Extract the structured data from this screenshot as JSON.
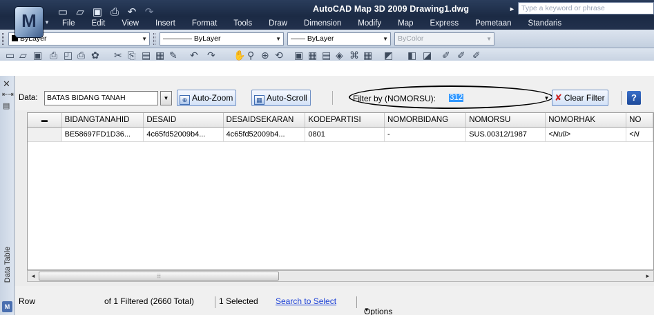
{
  "window": {
    "app_logo": "M",
    "title": "AutoCAD Map 3D 2009  Drawing1.dwg",
    "search_placeholder": "Type a keyword or phrase"
  },
  "menu": [
    "File",
    "Edit",
    "View",
    "Insert",
    "Format",
    "Tools",
    "Draw",
    "Dimension",
    "Modify",
    "Map",
    "Express",
    "Pemetaan",
    "Standaris"
  ],
  "properties": {
    "layer": "ByLayer",
    "linetype": "———— ByLayer",
    "lineweight": "—— ByLayer",
    "plotstyle": "ByColor"
  },
  "data_table": {
    "strip_title": "Data Table",
    "data_label": "Data:",
    "data_source": "BATAS BIDANG TANAH",
    "auto_zoom": "Auto-Zoom",
    "auto_scroll": "Auto-Scroll",
    "filter_label": "Filter by (NOMORSU):",
    "filter_value": "312",
    "clear_filter": "Clear Filter",
    "help": "?",
    "columns": [
      "",
      "BIDANGTANAHID",
      "DESAID",
      "DESAIDSEKARAN",
      "KODEPARTISI",
      "NOMORBIDANG",
      "NOMORSU",
      "NOMORHAK",
      "NO"
    ],
    "rows": [
      [
        "",
        "BE58697FD1D36...",
        "4c65fd52009b4...",
        "4c65fd52009b4...",
        "0801",
        "-",
        "SUS.00312/1987",
        "<Null>",
        "<N"
      ]
    ],
    "status": {
      "row_label": "Row",
      "filtered": "of 1 Filtered (2660 Total)",
      "selected": "1 Selected",
      "search": "Search to Select",
      "options": "Options"
    }
  }
}
